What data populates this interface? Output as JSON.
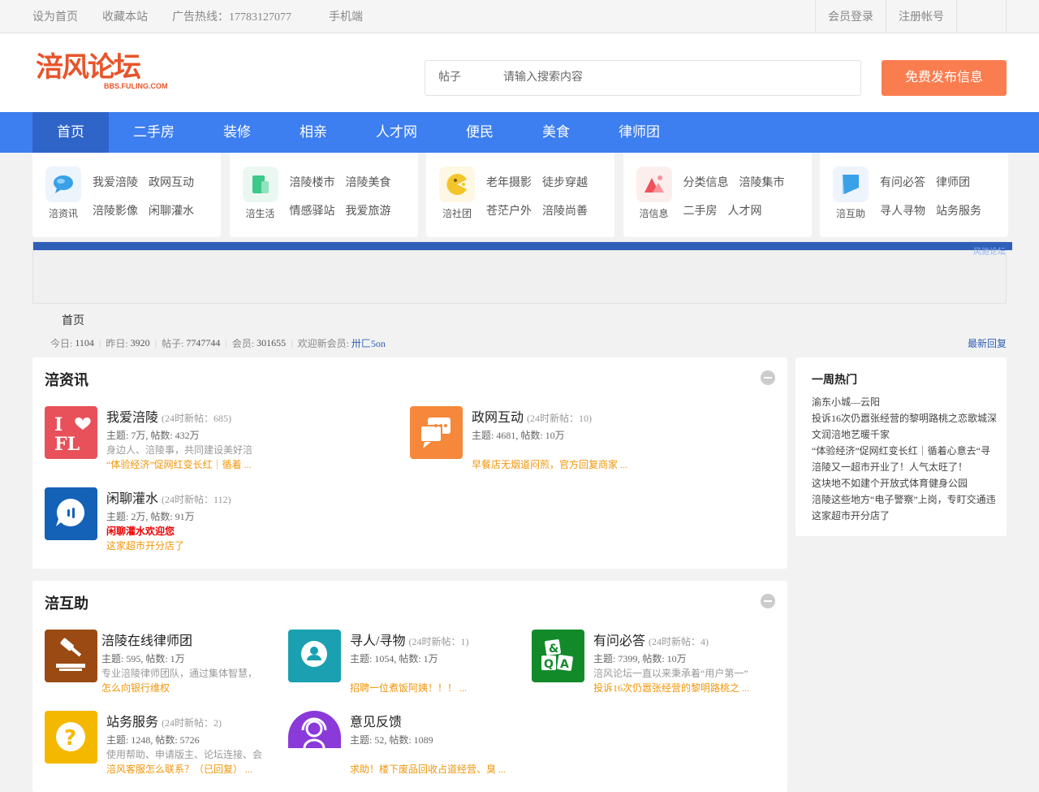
{
  "topbar": {
    "left": [
      "设为首页",
      "收藏本站",
      "广告热线：17783127077",
      "手机端"
    ],
    "login": "会员登录",
    "register": "注册帐号"
  },
  "header": {
    "logo_cn": "涪风论坛",
    "logo_en": "BBS.FULING.COM",
    "search_category": "帖子",
    "search_placeholder": "请输入搜索内容",
    "post_button": "免费发布信息"
  },
  "nav": [
    "首页",
    "二手房",
    "装修",
    "相亲",
    "人才网",
    "便民",
    "美食",
    "律师团"
  ],
  "quick": [
    {
      "caption": "涪资讯",
      "links": [
        "我爱涪陵",
        "政网互动",
        "涪陵影像",
        "闲聊灌水"
      ],
      "icon": "chat-bubble-icon",
      "color": "#3aa0e8"
    },
    {
      "caption": "涪生活",
      "links": [
        "涪陵楼市",
        "涪陵美食",
        "情感驿站",
        "我爱旅游"
      ],
      "icon": "building-icon",
      "color": "#3cc98a"
    },
    {
      "caption": "涪社团",
      "links": [
        "老年摄影",
        "徒步穿越",
        "苍茫户外",
        "涪陵尚善"
      ],
      "icon": "pacman-icon",
      "color": "#f4c52a"
    },
    {
      "caption": "涪信息",
      "links": [
        "分类信息",
        "涪陵集市",
        "二手房",
        "人才网"
      ],
      "icon": "mountain-icon",
      "color": "#f0505a"
    },
    {
      "caption": "涪互助",
      "links": [
        "有问必答",
        "律师团",
        "寻人寻物",
        "站务服务"
      ],
      "icon": "bookmark-icon",
      "color": "#3aa0e8"
    }
  ],
  "banner_text": "风驰论坛",
  "breadcrumb": "首页",
  "stats": {
    "today_label": "今日:",
    "today": "1104",
    "yesterday_label": "昨日:",
    "yesterday": "3920",
    "posts_label": "帖子:",
    "posts": "7747744",
    "members_label": "会员:",
    "members": "301655",
    "welcome_label": "欢迎新会员:",
    "newest": "卅匚5on",
    "latest_reply": "最新回复"
  },
  "section1": {
    "title": "涪资讯",
    "forums": [
      {
        "name": "我爱涪陵",
        "today": "(24时新帖：685)",
        "stat": "主题: 7万, 帖数: 432万",
        "desc": "身边人、涪陵事，共同建设美好涪",
        "last": "“体验经济”促网红变长红｜循着 ...",
        "icon": "i-love-fl-icon",
        "color": "#e8505a",
        "label": "I♥FL"
      },
      {
        "name": "政网互动",
        "today": "(24时新帖：10)",
        "stat": "主题: 4681, 帖数: 10万",
        "desc": "",
        "last": "早餐店无烟道闷煎，官方回复商家 ...",
        "icon": "chat-icon",
        "color": "#f5883a",
        "label": ""
      },
      {
        "name": "闲聊灌水",
        "today": "(24时新帖：112)",
        "stat": "主题: 2万, 帖数: 91万",
        "desc": "闲聊灌水欢迎您",
        "last": "这家超市开分店了",
        "icon": "voice-bubble-icon",
        "color": "#1461b8",
        "label": ""
      }
    ]
  },
  "section2": {
    "title": "涪互助",
    "forums": [
      {
        "name": "涪陵在线律师团",
        "today": "",
        "stat": "主题: 595, 帖数: 1万",
        "desc": "专业涪陵律师团队，通过集体智慧，",
        "last": "怎么向银行维权",
        "icon": "gavel-icon",
        "color": "#9a4a12",
        "label": ""
      },
      {
        "name": "寻人/寻物",
        "today": "(24时新帖：1)",
        "stat": "主题: 1054, 帖数: 1万",
        "desc": "",
        "last": "招聘一位煮饭阿姨！！！ ...",
        "icon": "person-search-icon",
        "color": "#1aa0b0",
        "label": ""
      },
      {
        "name": "有问必答",
        "today": "(24时新帖：4)",
        "stat": "主题: 7399, 帖数: 10万",
        "desc": "涪风论坛一直以来秉承着“用户第一”",
        "last": "投诉16次仍嚣张经营的黎明路桃之 ...",
        "icon": "qa-icon",
        "color": "#138a2a",
        "label": "& Q A"
      },
      {
        "name": "站务服务",
        "today": "(24时新帖：2)",
        "stat": "主题: 1248, 帖数: 5726",
        "desc": "使用帮助、申请版主、论坛连接、会",
        "last": "涪风客服怎么联系？（已回复） ...",
        "icon": "question-icon",
        "color": "#f5b800",
        "label": "?"
      },
      {
        "name": "意见反馈",
        "today": "",
        "stat": "主题: 52, 帖数: 1089",
        "desc": "",
        "last": "求助！楼下废品回收占道经营、臭 ...",
        "icon": "headset-icon",
        "color": "#8a3ad8",
        "label": ""
      }
    ]
  },
  "hot": {
    "title": "一周热门",
    "items": [
      "渝东小城—云阳",
      "投诉16次仍嚣张经营的黎明路桃之恋歌城深",
      "文润涪地艺暖千家",
      "“体验经济”促网红变长红｜循着心意去“寻",
      "涪陵又一超市开业了！人气太旺了！",
      "这块地不如建个开放式体育健身公园",
      "涪陵这些地方“电子警察”上岗，专盯交通违",
      "这家超市开分店了"
    ]
  }
}
